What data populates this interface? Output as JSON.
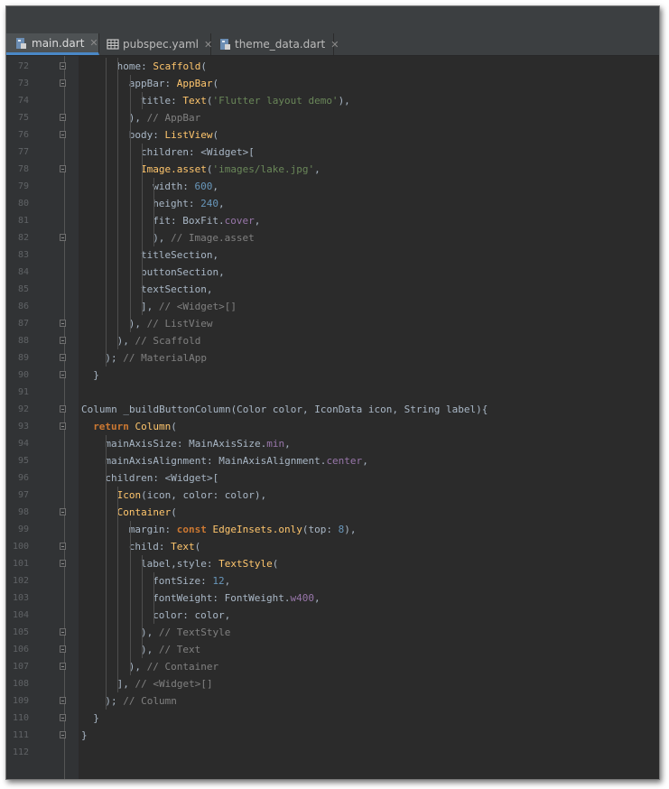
{
  "tabs": [
    {
      "label": "main.dart",
      "icon": "dart-file-icon",
      "active": true
    },
    {
      "label": "pubspec.yaml",
      "icon": "table-file-icon",
      "active": false
    },
    {
      "label": "theme_data.dart",
      "icon": "dart-file-icon",
      "active": false
    }
  ],
  "close_glyph": "✕",
  "colors": {
    "background": "#2b2b2b",
    "keyword": "#cc7832",
    "class": "#ffc66d",
    "string": "#6a8759",
    "number": "#6897bb",
    "comment": "#808080",
    "constant": "#9876aa",
    "plain": "#a9b7c6",
    "tab_underline": "#4a88c7"
  },
  "lines": [
    {
      "n": "72",
      "fold": "start",
      "tokens": [
        [
          "pl",
          "home: "
        ],
        [
          "cls",
          "Scaffold"
        ],
        [
          "pl",
          "("
        ]
      ]
    },
    {
      "n": "73",
      "fold": "start",
      "tokens": [
        [
          "pl",
          "appBar: "
        ],
        [
          "cls",
          "AppBar"
        ],
        [
          "pl",
          "("
        ]
      ]
    },
    {
      "n": "74",
      "fold": "",
      "tokens": [
        [
          "pl",
          "title: "
        ],
        [
          "cls",
          "Text"
        ],
        [
          "pl",
          "("
        ],
        [
          "str",
          "'Flutter layout demo'"
        ],
        [
          "pl",
          "),"
        ]
      ]
    },
    {
      "n": "75",
      "fold": "end",
      "tokens": [
        [
          "pl",
          "), "
        ],
        [
          "cm",
          "// AppBar"
        ]
      ]
    },
    {
      "n": "76",
      "fold": "start",
      "tokens": [
        [
          "pl",
          "body: "
        ],
        [
          "cls",
          "ListView"
        ],
        [
          "pl",
          "("
        ]
      ]
    },
    {
      "n": "77",
      "fold": "",
      "tokens": [
        [
          "pl",
          "children: <Widget>["
        ]
      ]
    },
    {
      "n": "78",
      "fold": "start",
      "tokens": [
        [
          "cls",
          "Image.asset"
        ],
        [
          "pl",
          "("
        ],
        [
          "str",
          "'images/lake.jpg'"
        ],
        [
          "pl",
          ","
        ]
      ]
    },
    {
      "n": "79",
      "fold": "",
      "tokens": [
        [
          "pl",
          "width: "
        ],
        [
          "num",
          "600"
        ],
        [
          "pl",
          ","
        ]
      ]
    },
    {
      "n": "80",
      "fold": "",
      "tokens": [
        [
          "pl",
          "height: "
        ],
        [
          "num",
          "240"
        ],
        [
          "pl",
          ","
        ]
      ]
    },
    {
      "n": "81",
      "fold": "",
      "tokens": [
        [
          "pl",
          "fit: BoxFit."
        ],
        [
          "cst",
          "cover"
        ],
        [
          "pl",
          ","
        ]
      ]
    },
    {
      "n": "82",
      "fold": "end",
      "tokens": [
        [
          "pl",
          "), "
        ],
        [
          "cm",
          "// Image.asset"
        ]
      ]
    },
    {
      "n": "83",
      "fold": "",
      "tokens": [
        [
          "pl",
          "titleSection,"
        ]
      ]
    },
    {
      "n": "84",
      "fold": "",
      "tokens": [
        [
          "pl",
          "buttonSection,"
        ]
      ]
    },
    {
      "n": "85",
      "fold": "",
      "tokens": [
        [
          "pl",
          "textSection,"
        ]
      ]
    },
    {
      "n": "86",
      "fold": "",
      "tokens": [
        [
          "pl",
          "], "
        ],
        [
          "cm",
          "// <Widget>[]"
        ]
      ]
    },
    {
      "n": "87",
      "fold": "end",
      "tokens": [
        [
          "pl",
          "), "
        ],
        [
          "cm",
          "// ListView"
        ]
      ]
    },
    {
      "n": "88",
      "fold": "end",
      "tokens": [
        [
          "pl",
          "), "
        ],
        [
          "cm",
          "// Scaffold"
        ]
      ]
    },
    {
      "n": "89",
      "fold": "end",
      "tokens": [
        [
          "pl",
          "); "
        ],
        [
          "cm",
          "// MaterialApp"
        ]
      ]
    },
    {
      "n": "90",
      "fold": "end",
      "tokens": [
        [
          "pl",
          "}"
        ]
      ]
    },
    {
      "n": "91",
      "fold": "",
      "tokens": []
    },
    {
      "n": "92",
      "fold": "start",
      "tokens": [
        [
          "pl",
          "Column _buildButtonColumn(Color color, IconData icon, String label){"
        ]
      ]
    },
    {
      "n": "93",
      "fold": "start",
      "tokens": [
        [
          "kw",
          "return "
        ],
        [
          "cls",
          "Column"
        ],
        [
          "pl",
          "("
        ]
      ]
    },
    {
      "n": "94",
      "fold": "",
      "tokens": [
        [
          "pl",
          "mainAxisSize: MainAxisSize."
        ],
        [
          "cst",
          "min"
        ],
        [
          "pl",
          ","
        ]
      ]
    },
    {
      "n": "95",
      "fold": "",
      "tokens": [
        [
          "pl",
          "mainAxisAlignment: MainAxisAlignment."
        ],
        [
          "cst",
          "center"
        ],
        [
          "pl",
          ","
        ]
      ]
    },
    {
      "n": "96",
      "fold": "",
      "tokens": [
        [
          "pl",
          "children: <Widget>["
        ]
      ]
    },
    {
      "n": "97",
      "fold": "",
      "tokens": [
        [
          "cls",
          "Icon"
        ],
        [
          "pl",
          "(icon, color: color),"
        ]
      ]
    },
    {
      "n": "98",
      "fold": "start",
      "tokens": [
        [
          "cls",
          "Container"
        ],
        [
          "pl",
          "("
        ]
      ]
    },
    {
      "n": "99",
      "fold": "",
      "tokens": [
        [
          "pl",
          "margin: "
        ],
        [
          "kw",
          "const "
        ],
        [
          "cls",
          "EdgeInsets.only"
        ],
        [
          "pl",
          "(top: "
        ],
        [
          "num",
          "8"
        ],
        [
          "pl",
          "),"
        ]
      ]
    },
    {
      "n": "100",
      "fold": "start",
      "tokens": [
        [
          "pl",
          "child: "
        ],
        [
          "cls",
          "Text"
        ],
        [
          "pl",
          "("
        ]
      ]
    },
    {
      "n": "101",
      "fold": "start",
      "tokens": [
        [
          "pl",
          "label,style: "
        ],
        [
          "cls",
          "TextStyle"
        ],
        [
          "pl",
          "("
        ]
      ]
    },
    {
      "n": "102",
      "fold": "",
      "tokens": [
        [
          "pl",
          "fontSize: "
        ],
        [
          "num",
          "12"
        ],
        [
          "pl",
          ","
        ]
      ]
    },
    {
      "n": "103",
      "fold": "",
      "tokens": [
        [
          "pl",
          "fontWeight: FontWeight."
        ],
        [
          "cst",
          "w400"
        ],
        [
          "pl",
          ","
        ]
      ]
    },
    {
      "n": "104",
      "fold": "",
      "tokens": [
        [
          "pl",
          "color: color,"
        ]
      ]
    },
    {
      "n": "105",
      "fold": "end",
      "tokens": [
        [
          "pl",
          "), "
        ],
        [
          "cm",
          "// TextStyle"
        ]
      ]
    },
    {
      "n": "106",
      "fold": "end",
      "tokens": [
        [
          "pl",
          "), "
        ],
        [
          "cm",
          "// Text"
        ]
      ]
    },
    {
      "n": "107",
      "fold": "end",
      "tokens": [
        [
          "pl",
          "), "
        ],
        [
          "cm",
          "// Container"
        ]
      ]
    },
    {
      "n": "108",
      "fold": "",
      "tokens": [
        [
          "pl",
          "], "
        ],
        [
          "cm",
          "// <Widget>[]"
        ]
      ]
    },
    {
      "n": "109",
      "fold": "end",
      "tokens": [
        [
          "pl",
          "); "
        ],
        [
          "cm",
          "// Column"
        ]
      ]
    },
    {
      "n": "110",
      "fold": "end",
      "tokens": [
        [
          "pl",
          "}"
        ]
      ]
    },
    {
      "n": "111",
      "fold": "end",
      "tokens": [
        [
          "pl",
          "}"
        ]
      ]
    },
    {
      "n": "112",
      "fold": "",
      "tokens": []
    }
  ]
}
